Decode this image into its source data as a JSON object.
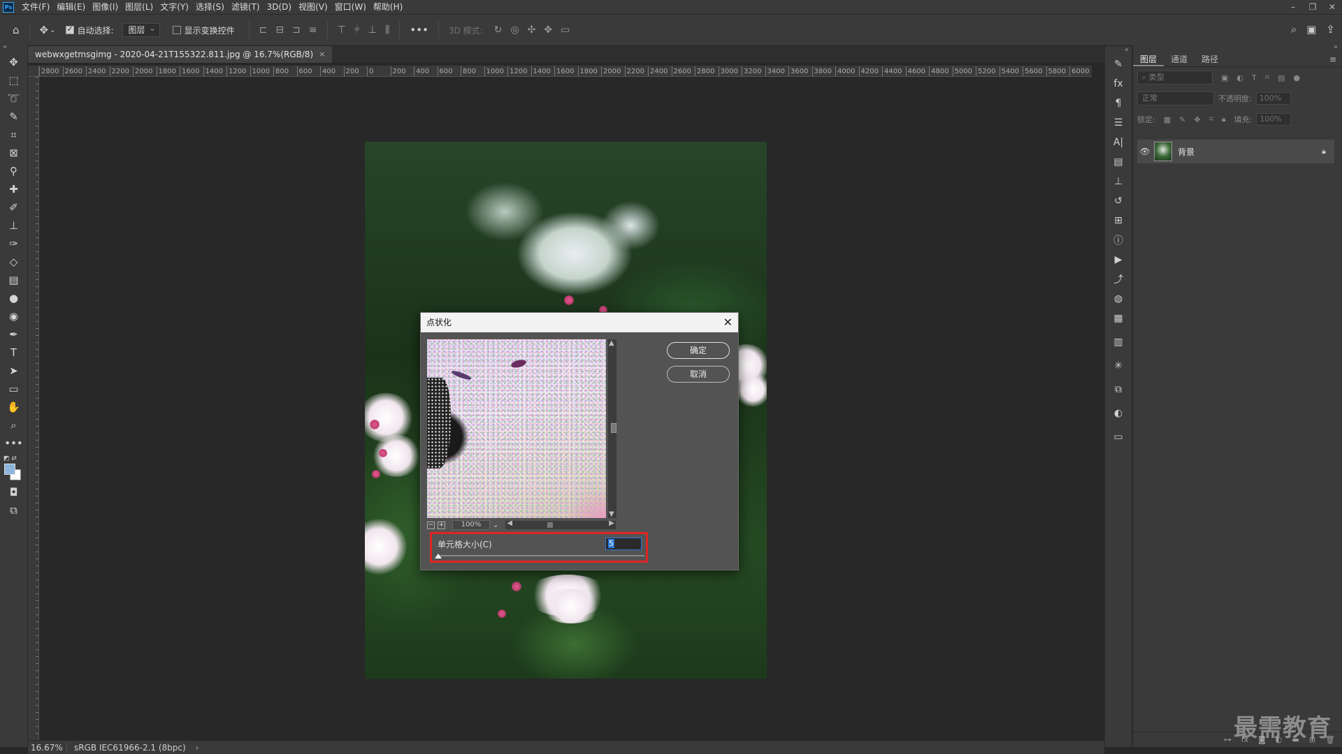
{
  "app": {
    "logo": "Ps"
  },
  "menu": [
    "文件(F)",
    "编辑(E)",
    "图像(I)",
    "图层(L)",
    "文字(Y)",
    "选择(S)",
    "滤镜(T)",
    "3D(D)",
    "视图(V)",
    "窗口(W)",
    "帮助(H)"
  ],
  "window_controls": [
    "–",
    "❐",
    "✕"
  ],
  "options": {
    "auto_select_label": "自动选择:",
    "auto_select_target": "图层",
    "show_transform_label": "显示变换控件",
    "mode_3d_label": "3D 模式:"
  },
  "document": {
    "tab_title": "webwxgetmsgimg - 2020-04-21T155322.811.jpg @ 16.7%(RGB/8)",
    "close": "×"
  },
  "ruler_marks": [
    "2800",
    "2600",
    "2400",
    "2200",
    "2000",
    "1800",
    "1600",
    "1400",
    "1200",
    "1000",
    "800",
    "600",
    "400",
    "200",
    "0",
    "200",
    "400",
    "600",
    "800",
    "1000",
    "1200",
    "1400",
    "1600",
    "1800",
    "2000",
    "2200",
    "2400",
    "2600",
    "2800",
    "3000",
    "3200",
    "3400",
    "3600",
    "3800",
    "4000",
    "4200",
    "4400",
    "4600",
    "4800",
    "5000",
    "5200",
    "5400",
    "5600",
    "5800",
    "6000"
  ],
  "dialog": {
    "title": "点状化",
    "close": "✕",
    "ok_label": "确定",
    "cancel_label": "取消",
    "preview_zoom": "100%",
    "zoom_minus": "−",
    "zoom_plus": "+",
    "cell_size_label": "单元格大小(C)",
    "cell_size_value": "5"
  },
  "layers_panel": {
    "tabs": [
      "图层",
      "通道",
      "路径"
    ],
    "filter_kind": "类型",
    "blend_mode": "正常",
    "opacity_label": "不透明度:",
    "opacity_value": "100%",
    "lock_label": "锁定:",
    "fill_label": "填充:",
    "fill_value": "100%",
    "layers": [
      {
        "name": "背景",
        "visible": true,
        "locked": true
      }
    ]
  },
  "status": {
    "zoom": "16.67%",
    "color_profile": "sRGB IEC61966-2.1 (8bpc)",
    "arrow": "›"
  },
  "watermark": "最需教育"
}
